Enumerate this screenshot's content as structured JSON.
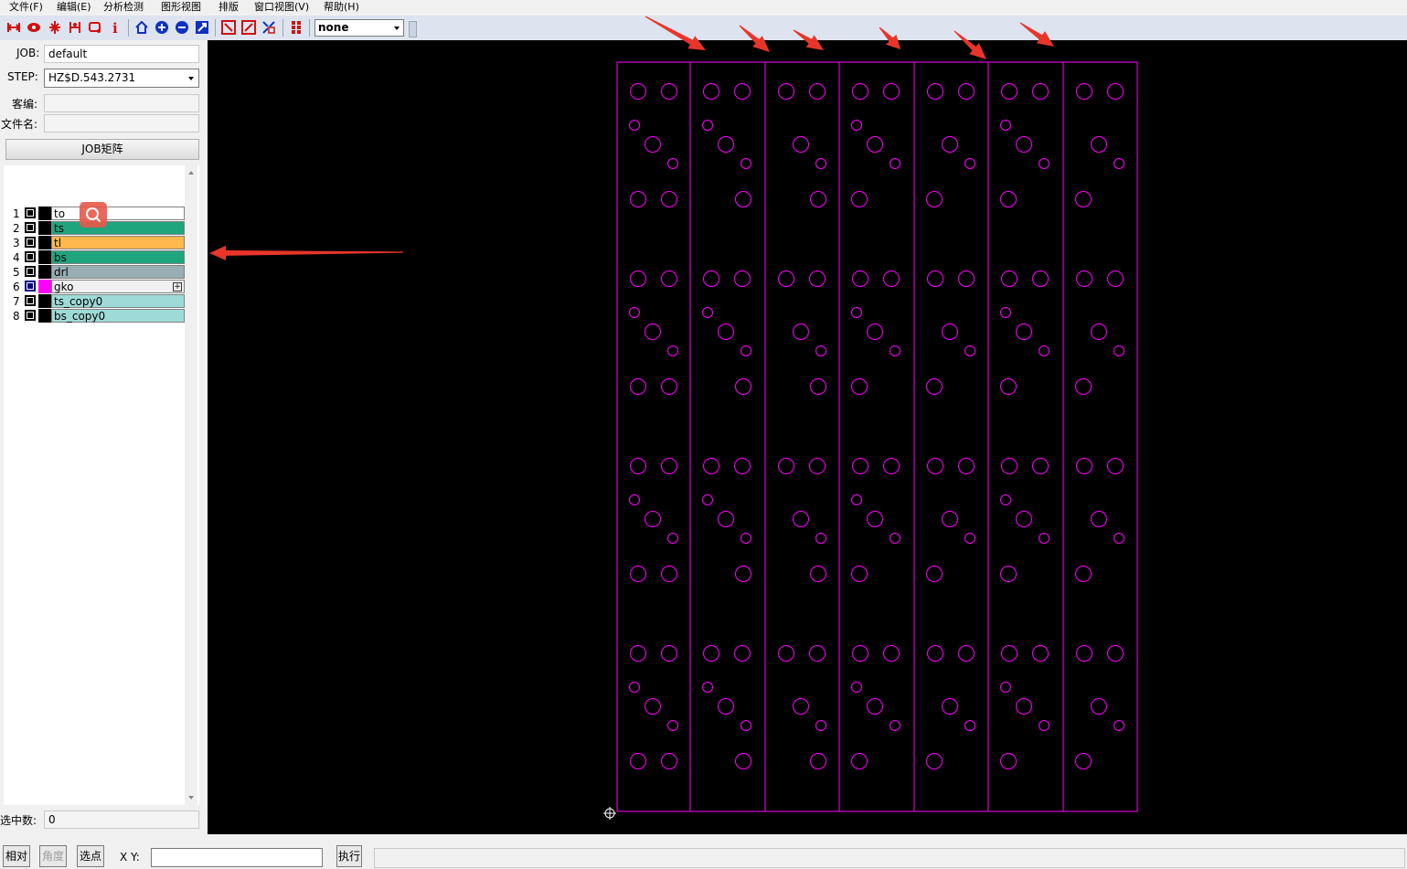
{
  "menu": [
    "文件(F)",
    "编辑(E)",
    "分析检测",
    "图形视图",
    "排版",
    "窗口视图(V)",
    "帮助(H)"
  ],
  "toolbar": {
    "icons": [
      "flip-icon",
      "red-eye-icon",
      "split-icon",
      "cut-icon",
      "rect-select-icon",
      "info-icon",
      "home-icon",
      "zoom-in-icon",
      "zoom-out-icon",
      "zoom-fit-icon",
      "window-zoom-icon",
      "zoom-box-icon",
      "snap-icon",
      "grid-icon"
    ],
    "step_combo": "none"
  },
  "job": {
    "label": "JOB:",
    "value": "default"
  },
  "step": {
    "label": "STEP:",
    "value": "HZ$D.543.2731"
  },
  "customer": {
    "label": "客编:",
    "value": ""
  },
  "filename": {
    "label": "文件名:",
    "value": ""
  },
  "job_matrix_button": "JOB矩阵",
  "layers": [
    {
      "num": "1",
      "name": "to",
      "color": "#ffffff",
      "selected": false
    },
    {
      "num": "2",
      "name": "ts",
      "color": "#1fa57e",
      "selected": false
    },
    {
      "num": "3",
      "name": "tl",
      "color": "#ffb84d",
      "selected": false
    },
    {
      "num": "4",
      "name": "bs",
      "color": "#1fa57e",
      "selected": false
    },
    {
      "num": "5",
      "name": "drl",
      "color": "#99aeb4",
      "selected": false
    },
    {
      "num": "6",
      "name": "gko",
      "color": "#f0f0f0",
      "selected": true
    },
    {
      "num": "7",
      "name": "ts_copy0",
      "color": "#9edbd8",
      "selected": false
    },
    {
      "num": "8",
      "name": "bs_copy0",
      "color": "#9edbd8",
      "selected": false
    }
  ],
  "selected_count": {
    "label": "选中数:",
    "value": "0"
  },
  "bottom": {
    "relative_button": "相对",
    "angle_button": "角度",
    "pick_button": "选点",
    "xy_label": "X Y:",
    "xy_value": "",
    "execute_button": "执行"
  },
  "colors": {
    "outline": "#ff00ff",
    "annotation_arrow": "#e8352a",
    "canvas_bg": "#000000"
  }
}
